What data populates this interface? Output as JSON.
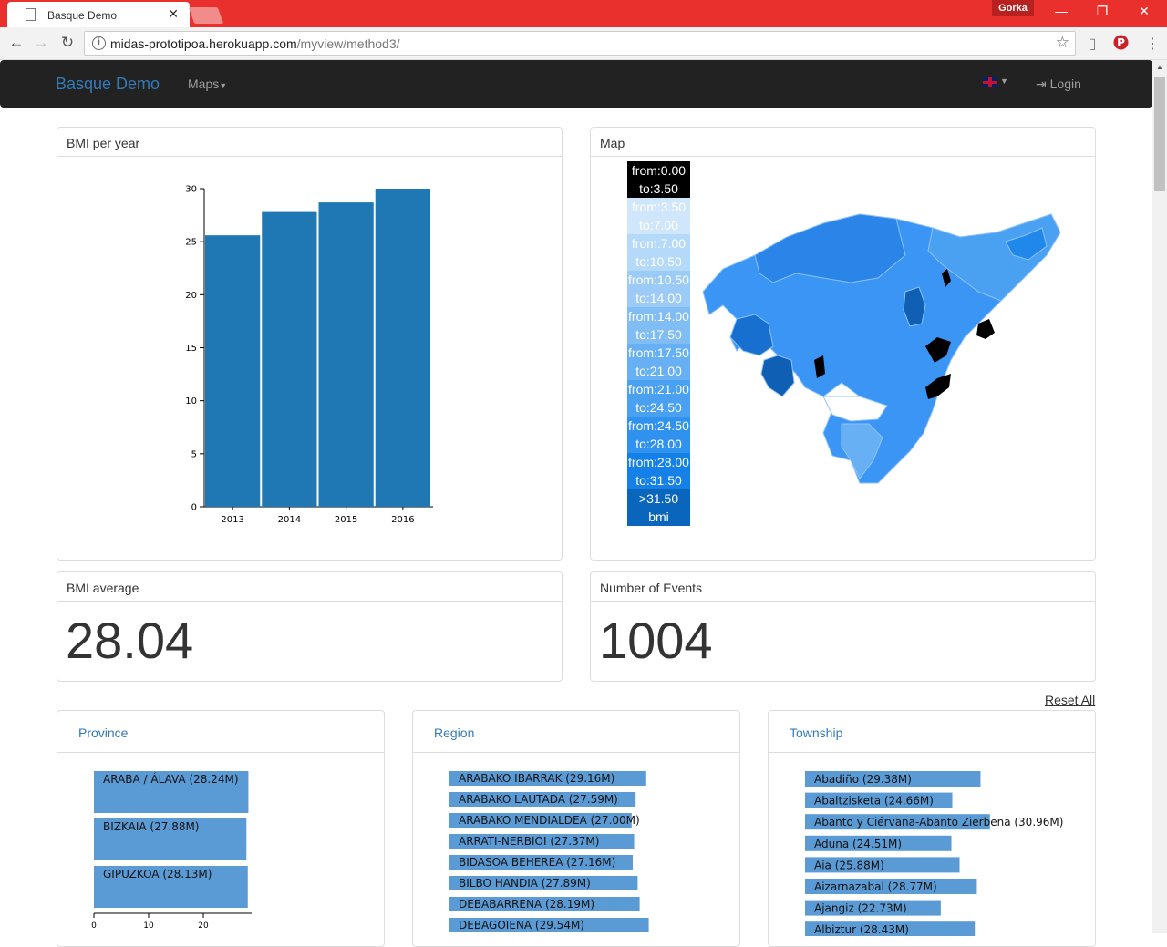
{
  "browser": {
    "tab_title": "Basque Demo",
    "profile_name": "Gorka",
    "url_host": "midas-prototipoa.herokuapp.com",
    "url_path": "/myview/method3/"
  },
  "navbar": {
    "brand": "Basque Demo",
    "maps_menu": "Maps",
    "login": "Login"
  },
  "panels": {
    "bmi_chart_title": "BMI per year",
    "map_title": "Map",
    "bmi_avg_title": "BMI average",
    "bmi_avg_value": "28.04",
    "events_title": "Number of Events",
    "events_value": "1004",
    "province_title": "Province",
    "region_title": "Region",
    "township_title": "Township"
  },
  "reset_all": "Reset All",
  "map_legend": [
    {
      "line1": "from:0.00",
      "line2": "to:3.50",
      "color": "#000000"
    },
    {
      "line1": "from:3.50",
      "line2": "to:7.00",
      "color": "#cfe6fb"
    },
    {
      "line1": "from:7.00",
      "line2": "to:10.50",
      "color": "#b5d9f9"
    },
    {
      "line1": "from:10.50",
      "line2": "to:14.00",
      "color": "#9ccbf7"
    },
    {
      "line1": "from:14.00",
      "line2": "to:17.50",
      "color": "#80bdf5"
    },
    {
      "line1": "from:17.50",
      "line2": "to:21.00",
      "color": "#66b0f3"
    },
    {
      "line1": "from:21.00",
      "line2": "to:24.50",
      "color": "#4aa1f1"
    },
    {
      "line1": "from:24.50",
      "line2": "to:28.00",
      "color": "#2f92ee"
    },
    {
      "line1": "from:28.00",
      "line2": "to:31.50",
      "color": "#1580e6"
    },
    {
      "line1": ">31.50",
      "line2": "bmi",
      "color": "#0a66bd"
    }
  ],
  "chart_data": [
    {
      "type": "bar",
      "title": "BMI per year",
      "categories": [
        "2013",
        "2014",
        "2015",
        "2016"
      ],
      "values": [
        25.6,
        27.8,
        28.7,
        30.0
      ],
      "ylim": [
        0,
        30
      ],
      "yticks": [
        0,
        5,
        10,
        15,
        20,
        25,
        30
      ],
      "color": "#1f77b4"
    },
    {
      "type": "bar",
      "orientation": "horizontal",
      "title": "Province",
      "categories": [
        "ARABA / ÁLAVA (28.24M)",
        "BIZKAIA (27.88M)",
        "GIPUZKOA (28.13M)"
      ],
      "values": [
        28.24,
        27.88,
        28.13
      ],
      "xticks": [
        0,
        10,
        20
      ],
      "xlim": [
        0,
        28.5
      ]
    },
    {
      "type": "bar",
      "orientation": "horizontal",
      "title": "Region",
      "categories": [
        "ARABAKO IBARRAK (29.16M)",
        "ARABAKO LAUTADA (27.59M)",
        "ARABAKO MENDIALDEA (27.00M)",
        "ARRATI-NERBIOI (27.37M)",
        "BIDASOA BEHEREA (27.16M)",
        "BILBO HANDIA (27.89M)",
        "DEBABARRENA (28.19M)",
        "DEBAGOIENA (29.54M)"
      ],
      "values": [
        29.16,
        27.59,
        27.0,
        27.37,
        27.16,
        27.89,
        28.19,
        29.54
      ]
    },
    {
      "type": "bar",
      "orientation": "horizontal",
      "title": "Township",
      "categories": [
        "Abadiño (29.38M)",
        "Abaltzisketa (24.66M)",
        "Abanto y Ciérvana-Abanto Zierbena (30.96M)",
        "Aduna (24.51M)",
        "Aia (25.88M)",
        "Aizarnazabal (28.77M)",
        "Ajangiz (22.73M)",
        "Albiztur (28.43M)"
      ],
      "values": [
        29.38,
        24.66,
        30.96,
        24.51,
        25.88,
        28.77,
        22.73,
        28.43
      ]
    }
  ]
}
